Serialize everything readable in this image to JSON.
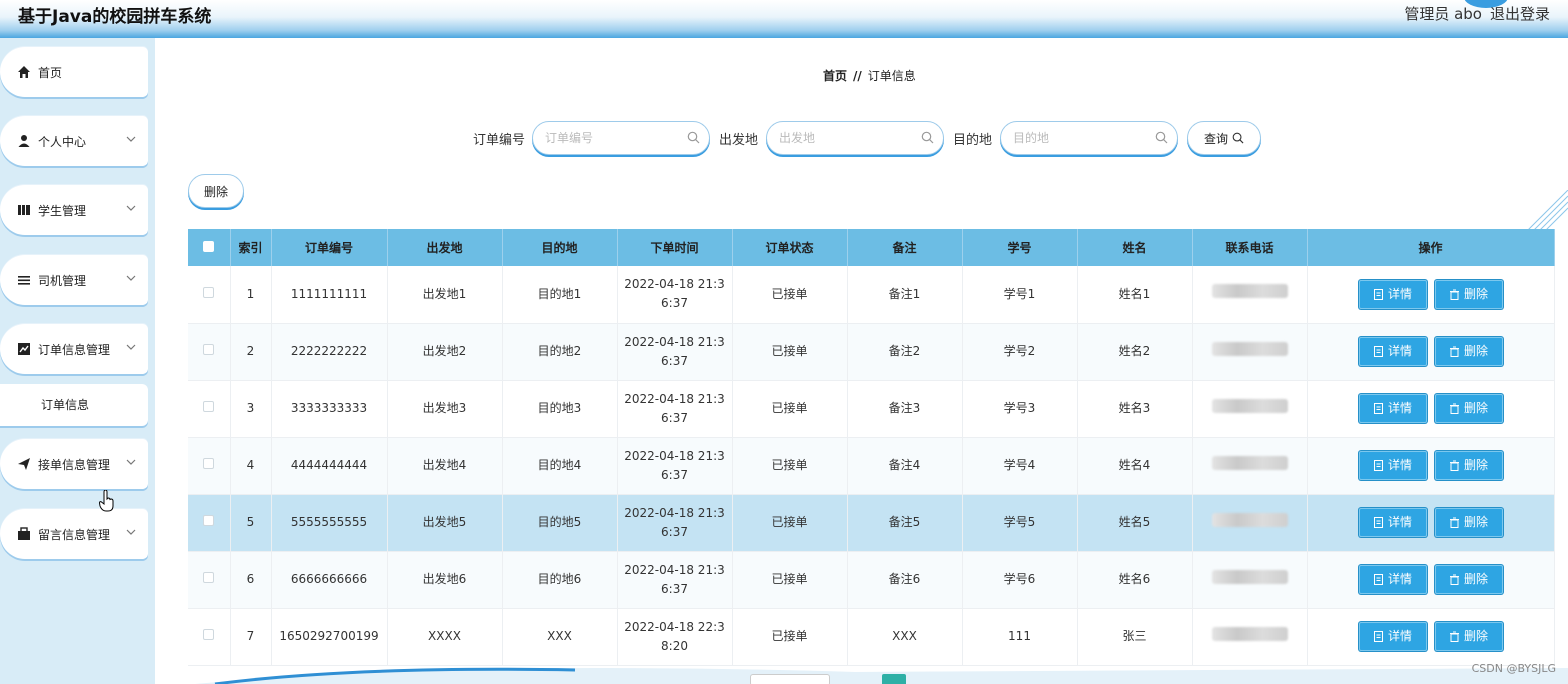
{
  "header": {
    "title": "基于Java的校园拼车系统",
    "user": "管理员 abo",
    "logout": "退出登录"
  },
  "sidebar": {
    "items": [
      {
        "label": "首页",
        "icon": "home-icon"
      },
      {
        "label": "个人中心",
        "icon": "user-icon"
      },
      {
        "label": "学生管理",
        "icon": "book-icon"
      },
      {
        "label": "司机管理",
        "icon": "list-icon"
      },
      {
        "label": "订单信息管理",
        "icon": "chart-icon"
      },
      {
        "label": "接单信息管理",
        "icon": "send-icon"
      },
      {
        "label": "留言信息管理",
        "icon": "wallet-icon"
      }
    ],
    "sub_item": "订单信息"
  },
  "breadcrumb": {
    "home": "首页",
    "sep": "//",
    "current": "订单信息"
  },
  "search": {
    "order_no_label": "订单编号",
    "order_no_placeholder": "订单编号",
    "from_label": "出发地",
    "from_placeholder": "出发地",
    "to_label": "目的地",
    "to_placeholder": "目的地",
    "query_button": "查询"
  },
  "toolbar": {
    "delete_button": "删除"
  },
  "table": {
    "headers": [
      "索引",
      "订单编号",
      "出发地",
      "目的地",
      "下单时间",
      "订单状态",
      "备注",
      "学号",
      "姓名",
      "联系电话",
      "操作"
    ],
    "detail_label": "详情",
    "delete_label": "删除",
    "rows": [
      {
        "index": "1",
        "order_no": "1111111111",
        "from": "出发地1",
        "to": "目的地1",
        "time1": "2022-04-18 21:3",
        "time2": "6:37",
        "status": "已接单",
        "note": "备注1",
        "student_no": "学号1",
        "name": "姓名1"
      },
      {
        "index": "2",
        "order_no": "2222222222",
        "from": "出发地2",
        "to": "目的地2",
        "time1": "2022-04-18 21:3",
        "time2": "6:37",
        "status": "已接单",
        "note": "备注2",
        "student_no": "学号2",
        "name": "姓名2"
      },
      {
        "index": "3",
        "order_no": "3333333333",
        "from": "出发地3",
        "to": "目的地3",
        "time1": "2022-04-18 21:3",
        "time2": "6:37",
        "status": "已接单",
        "note": "备注3",
        "student_no": "学号3",
        "name": "姓名3"
      },
      {
        "index": "4",
        "order_no": "4444444444",
        "from": "出发地4",
        "to": "目的地4",
        "time1": "2022-04-18 21:3",
        "time2": "6:37",
        "status": "已接单",
        "note": "备注4",
        "student_no": "学号4",
        "name": "姓名4"
      },
      {
        "index": "5",
        "order_no": "5555555555",
        "from": "出发地5",
        "to": "目的地5",
        "time1": "2022-04-18 21:3",
        "time2": "6:37",
        "status": "已接单",
        "note": "备注5",
        "student_no": "学号5",
        "name": "姓名5"
      },
      {
        "index": "6",
        "order_no": "6666666666",
        "from": "出发地6",
        "to": "目的地6",
        "time1": "2022-04-18 21:3",
        "time2": "6:37",
        "status": "已接单",
        "note": "备注6",
        "student_no": "学号6",
        "name": "姓名6"
      },
      {
        "index": "7",
        "order_no": "1650292700199",
        "from": "XXXX",
        "to": "XXX",
        "time1": "2022-04-18 22:3",
        "time2": "8:20",
        "status": "已接单",
        "note": "XXX",
        "student_no": "111",
        "name": "张三"
      }
    ]
  },
  "watermark": "CSDN @BYSJLG",
  "colors": {
    "accent": "#2ea5e3",
    "header_row": "#6cbde4",
    "sidebar_bg": "#d8ecf7",
    "hover_row": "#c4e3f3"
  }
}
